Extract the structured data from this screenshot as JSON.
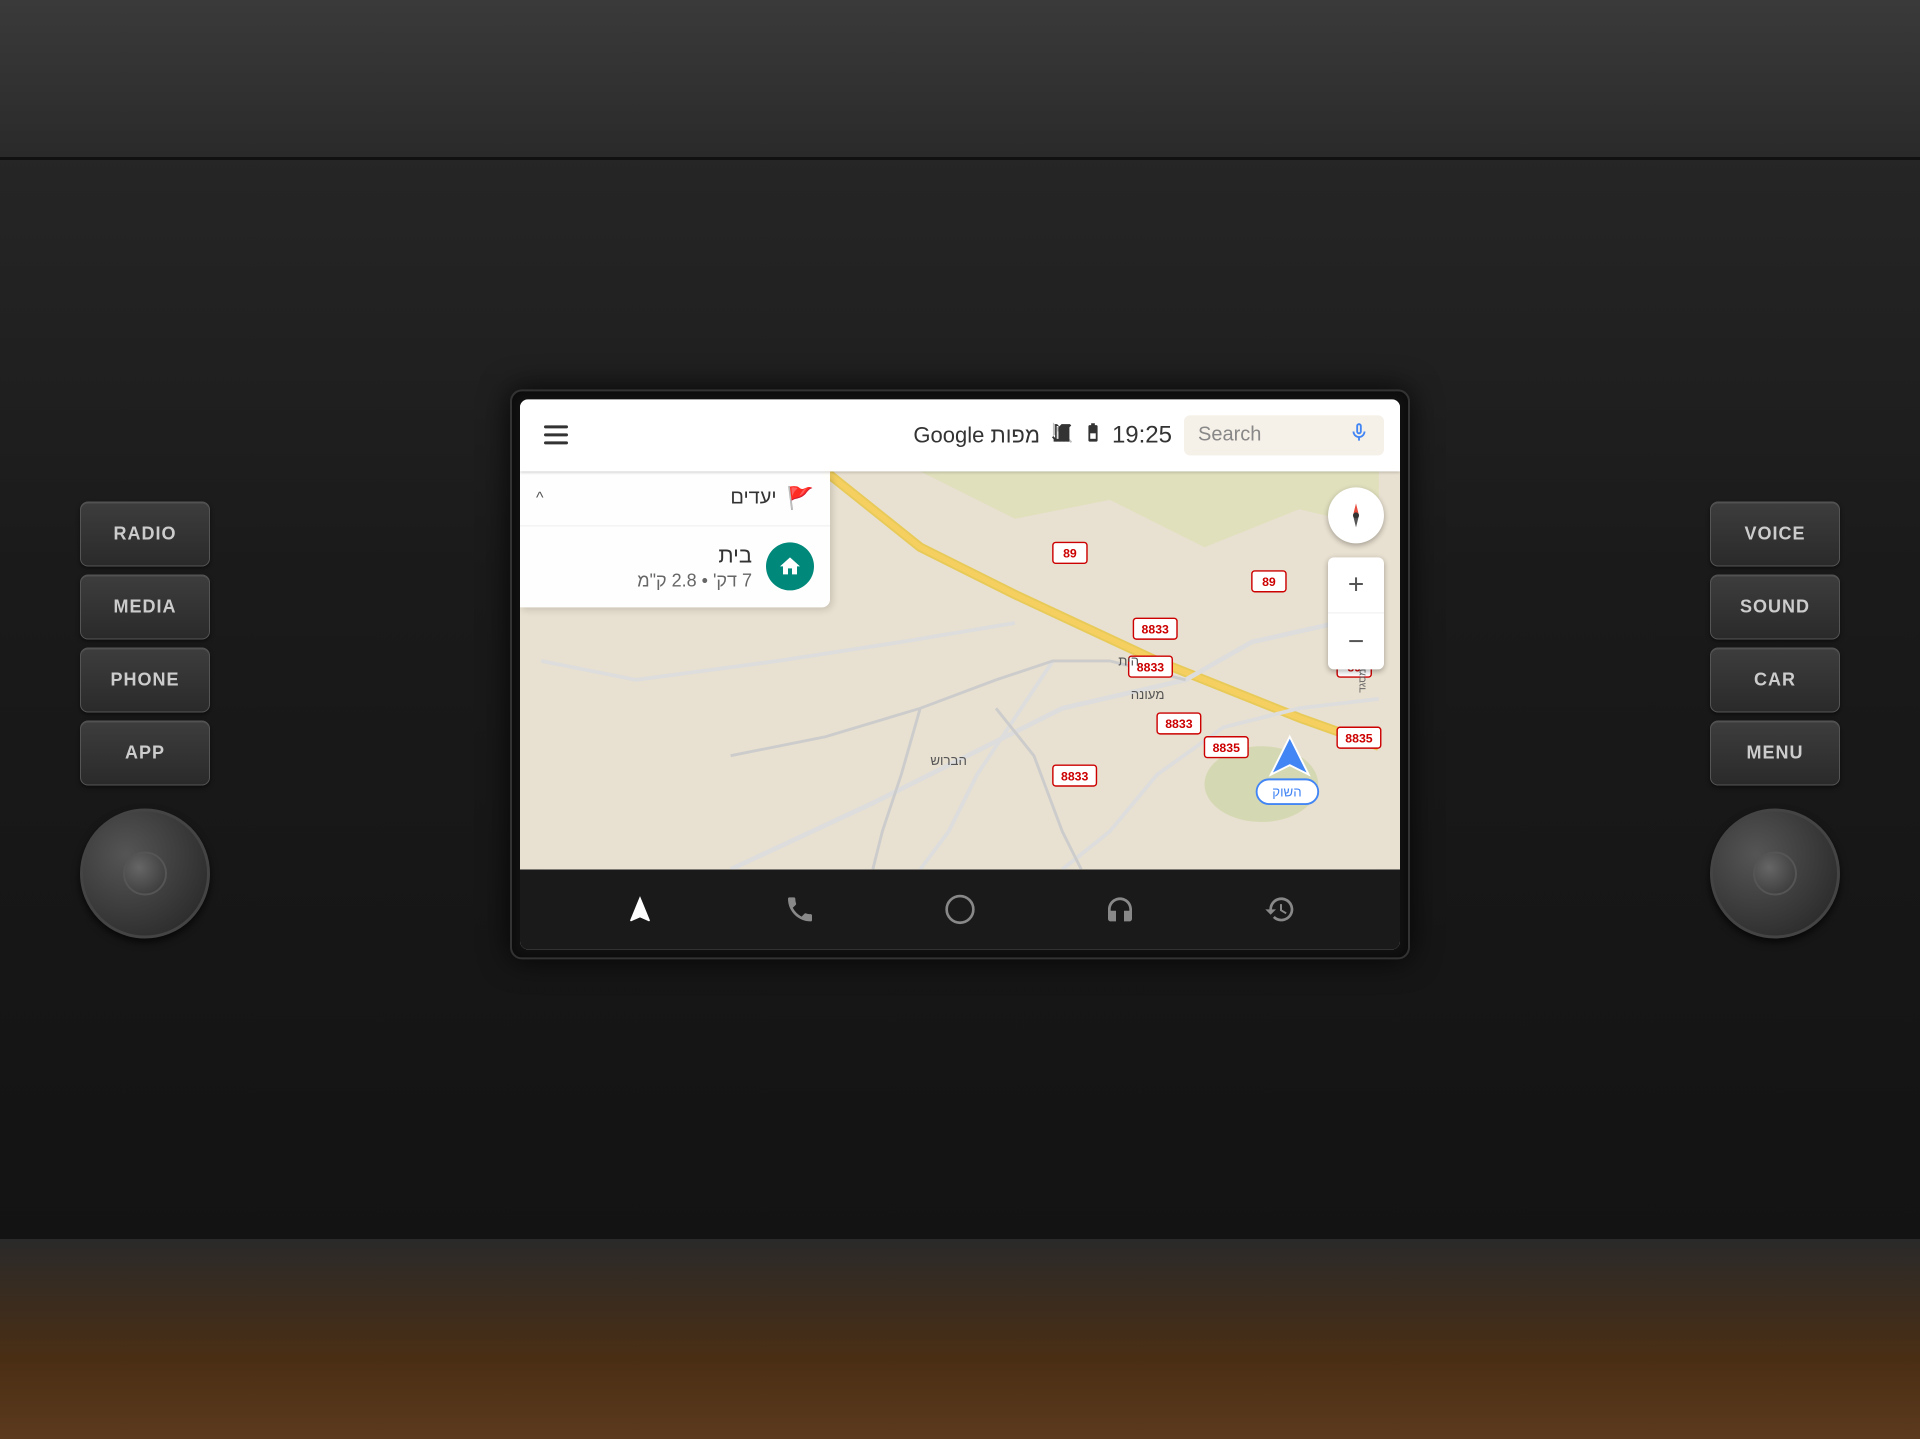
{
  "dashboard": {
    "left_buttons": [
      "RADIO",
      "MEDIA",
      "PHONE",
      "APP"
    ],
    "right_buttons": [
      "VOICE",
      "SOUND",
      "CAR",
      "MENU"
    ]
  },
  "topbar": {
    "title": "מפות Google",
    "time": "19:25",
    "search_placeholder": "Search"
  },
  "destinations": {
    "header_title": "יעדים",
    "chevron": "^",
    "items": [
      {
        "name": "בית",
        "details": "7 דק' • 2.8 ק\"מ"
      }
    ]
  },
  "map": {
    "road_labels": [
      "89",
      "8833",
      "8833",
      "8833",
      "8835",
      "8835",
      "8833"
    ],
    "location_label": "השוק",
    "place_labels": [
      "הית",
      "מעונה",
      "הברוש"
    ]
  },
  "bottomnav": {
    "items": [
      "navigation",
      "phone",
      "home",
      "headphones",
      "recent"
    ]
  }
}
